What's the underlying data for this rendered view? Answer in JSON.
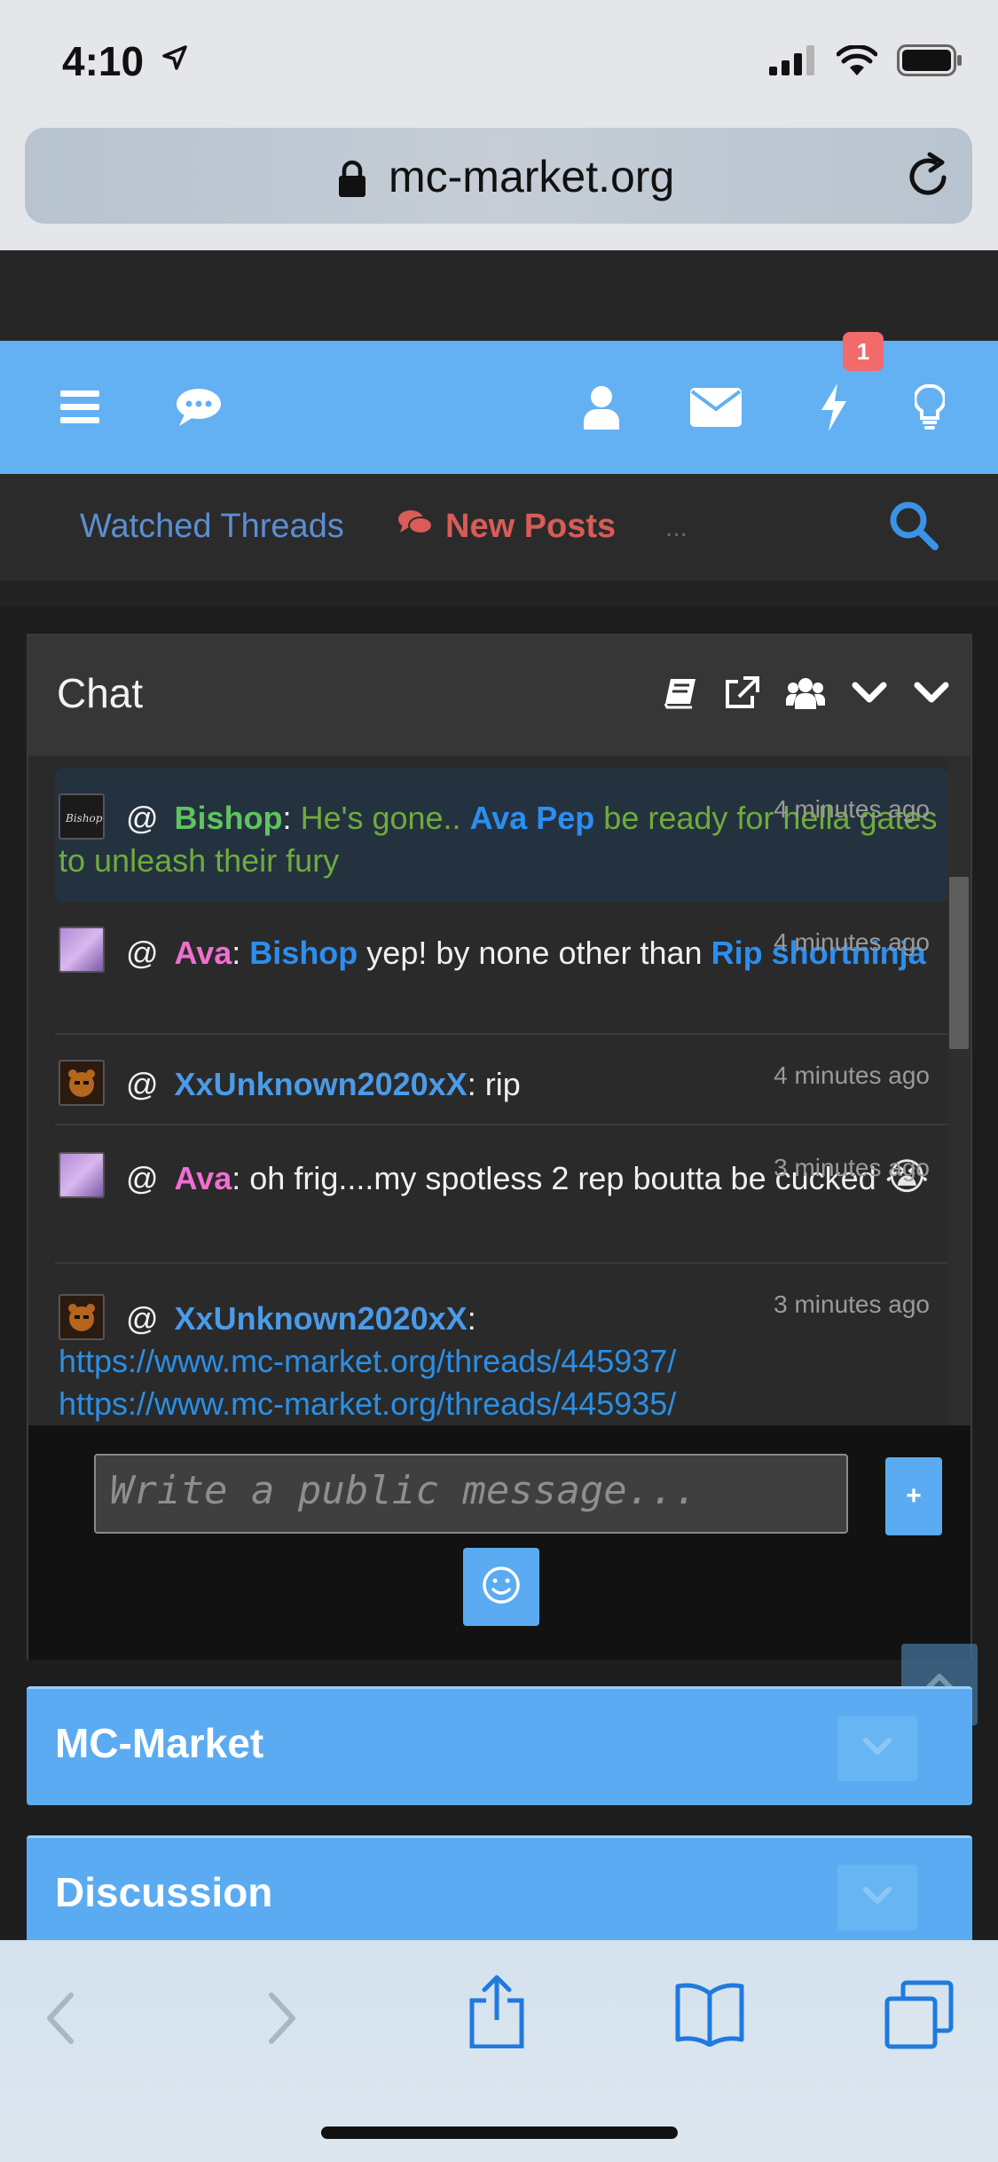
{
  "status_bar": {
    "time": "4:10"
  },
  "browser": {
    "url": "mc-market.org"
  },
  "notifications": {
    "alerts_badge": "1"
  },
  "subnav": {
    "watched_threads": "Watched Threads",
    "new_posts": "New Posts",
    "more": "..."
  },
  "chat": {
    "title": "Chat",
    "messages": [
      {
        "at": "@",
        "user": "Bishop",
        "sep": ":",
        "text_1": " He's gone.. ",
        "mention": "Ava Pep",
        "text_2": " be ready for hella gates to unleash their fury",
        "time": "4 minutes ago"
      },
      {
        "at": "@",
        "user": "Ava",
        "sep": ":",
        "mention_1": "Bishop",
        "text_1": " yep! by none other than ",
        "mention_2": "Rip shortninja",
        "time": "4 minutes ago"
      },
      {
        "at": "@",
        "user": "XxUnknown2020xX",
        "sep": ":",
        "text": " rip",
        "time": "4 minutes ago"
      },
      {
        "at": "@",
        "user": "Ava",
        "sep": ":",
        "text": " oh frig....my spotless 2 rep boutta be cucked",
        "emoji": "😭",
        "time": "3 minutes ago"
      },
      {
        "at": "@",
        "user": "XxUnknown2020xX",
        "sep": ":",
        "link_1": "https://www.mc-market.org/threads/445937/",
        "link_2": "https://www.mc-market.org/threads/445935/",
        "time": "3 minutes ago"
      }
    ],
    "input_placeholder": "Write a public message...",
    "plus_label": "+"
  },
  "categories": [
    {
      "title": "MC-Market"
    },
    {
      "title": "Discussion"
    }
  ],
  "colors": {
    "nav_blue": "#63b1f3",
    "alert_red": "#f26a6a",
    "new_posts_red": "#d95c56",
    "link_blue": "#2a8fe6"
  }
}
